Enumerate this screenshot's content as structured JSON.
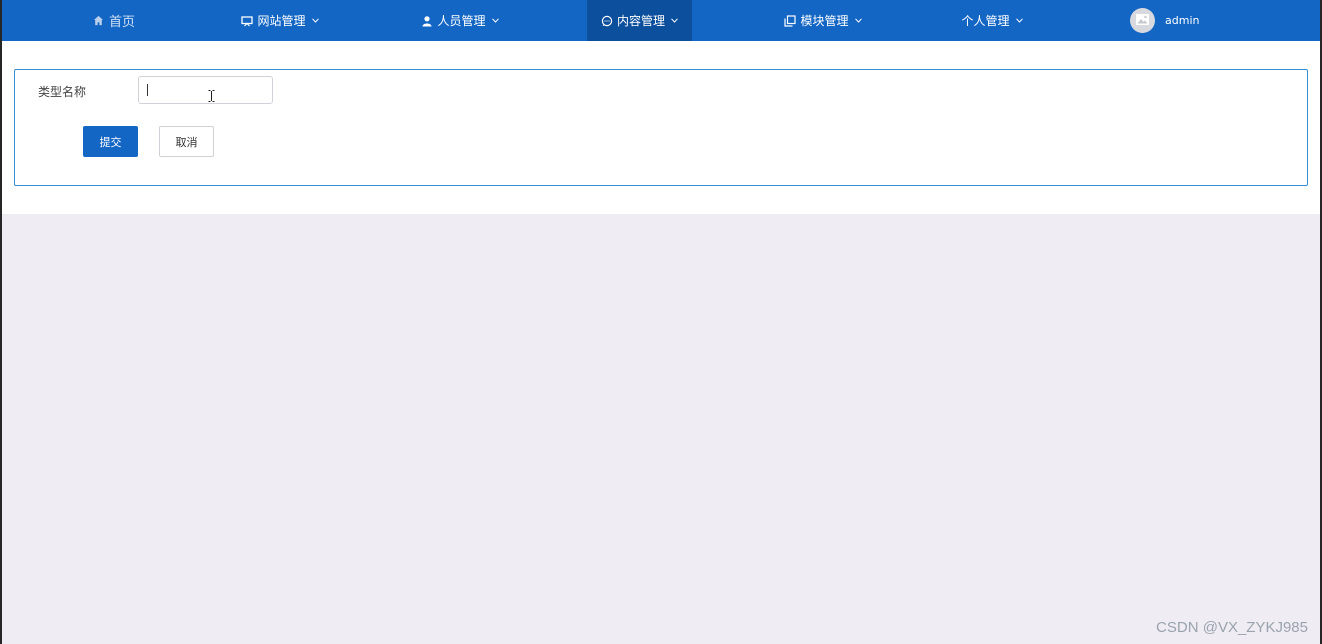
{
  "nav": {
    "home": {
      "label": "首页",
      "icon": "home-icon"
    },
    "items": [
      {
        "label": "网站管理",
        "icon": "monitor-icon"
      },
      {
        "label": "人员管理",
        "icon": "person-icon"
      },
      {
        "label": "内容管理",
        "icon": "chat-icon"
      },
      {
        "label": "模块管理",
        "icon": "copy-icon"
      },
      {
        "label": "个人管理"
      }
    ],
    "user": {
      "name": "admin",
      "icon": "avatar-image-icon"
    }
  },
  "form": {
    "type_name_label": "类型名称",
    "type_name_value": "",
    "submit_label": "提交",
    "cancel_label": "取消"
  },
  "watermark": "CSDN @VX_ZYKJ985",
  "colors": {
    "nav_bg": "#1366c4",
    "nav_active": "#0c4f9c",
    "primary_button": "#1366c4",
    "page_bg": "#efedf3",
    "card_border": "#3b8fd1"
  }
}
